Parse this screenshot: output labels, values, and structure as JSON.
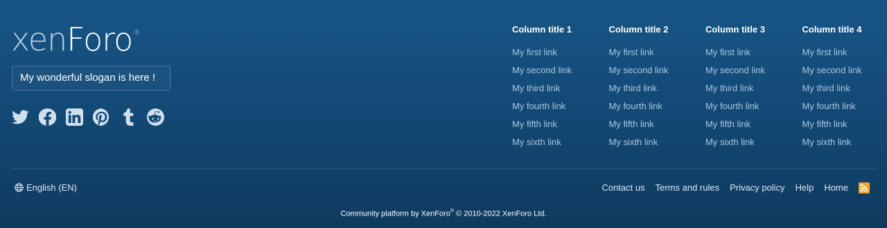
{
  "brand": {
    "logo_part1": "xen",
    "logo_part2": "Foro",
    "logo_reg": "®",
    "slogan": "My wonderful slogan is here !"
  },
  "social": [
    {
      "name": "twitter-icon"
    },
    {
      "name": "facebook-icon"
    },
    {
      "name": "linkedin-icon"
    },
    {
      "name": "pinterest-icon"
    },
    {
      "name": "tumblr-icon"
    },
    {
      "name": "reddit-icon"
    }
  ],
  "columns": [
    {
      "title": "Column title 1",
      "links": [
        "My first link",
        "My second link",
        "My third link",
        "My fourth link",
        "My fifth link",
        "My sixth link"
      ]
    },
    {
      "title": "Column title 2",
      "links": [
        "My first link",
        "My second link",
        "My third link",
        "My fourth link",
        "My fifth link",
        "My sixth link"
      ]
    },
    {
      "title": "Column title 3",
      "links": [
        "My first link",
        "My second link",
        "My third link",
        "My fourth link",
        "My fifth link",
        "My sixth link"
      ]
    },
    {
      "title": "Column title 4",
      "links": [
        "My first link",
        "My second link",
        "My third link",
        "My fourth link",
        "My fifth link",
        "My sixth link"
      ]
    }
  ],
  "footer": {
    "language": "English (EN)",
    "links": [
      "Contact us",
      "Terms and rules",
      "Privacy policy",
      "Help",
      "Home"
    ],
    "copyright_pre": "Community platform by XenForo",
    "copyright_reg": "®",
    "copyright_post": " © 2010-2022 XenForo Ltd."
  },
  "colors": {
    "background": "#134a76",
    "link": "#aac6e2",
    "rss": "#f0a429"
  }
}
